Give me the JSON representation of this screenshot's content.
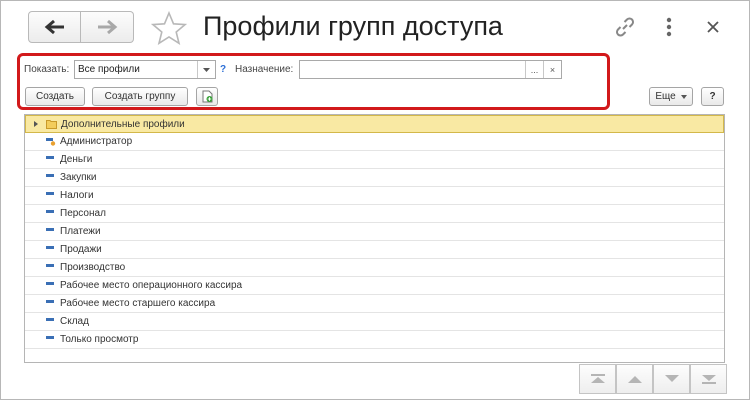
{
  "window": {
    "title": "Профили групп доступа"
  },
  "filters": {
    "show_label": "Показать:",
    "show_value": "Все профили",
    "help_mark": "?",
    "purpose_label": "Назначение:",
    "purpose_value": "",
    "purpose_select_label": "...",
    "purpose_clear_label": "×"
  },
  "toolbar": {
    "create_label": "Создать",
    "create_group_label": "Создать группу",
    "more_label": "Еще",
    "help_label": "?"
  },
  "list": {
    "items": [
      {
        "label": "Дополнительные профили",
        "type": "folder",
        "selected": true
      },
      {
        "label": "Администратор",
        "type": "profile-special"
      },
      {
        "label": "Деньги",
        "type": "profile"
      },
      {
        "label": "Закупки",
        "type": "profile"
      },
      {
        "label": "Налоги",
        "type": "profile"
      },
      {
        "label": "Персонал",
        "type": "profile"
      },
      {
        "label": "Платежи",
        "type": "profile"
      },
      {
        "label": "Продажи",
        "type": "profile"
      },
      {
        "label": "Производство",
        "type": "profile"
      },
      {
        "label": "Рабочее место операционного кассира",
        "type": "profile"
      },
      {
        "label": "Рабочее место старшего кассира",
        "type": "profile"
      },
      {
        "label": "Склад",
        "type": "profile"
      },
      {
        "label": "Только просмотр",
        "type": "profile"
      }
    ]
  },
  "icons": {
    "back": "arrow-left-icon",
    "forward": "arrow-right-icon",
    "favorite": "star-icon",
    "link": "link-icon",
    "menu": "more-vertical-icon",
    "close": "close-icon"
  },
  "colors": {
    "panel_highlight": "#d2191b",
    "selected_row": "#f9e9a3",
    "folder": "#e8b73a",
    "profile": "#3a6fb5"
  }
}
